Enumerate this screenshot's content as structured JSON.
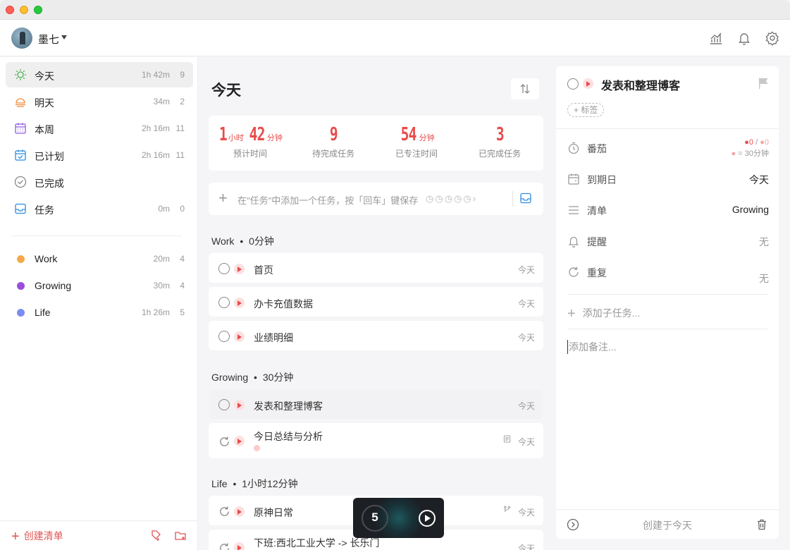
{
  "header": {
    "username": "墨七",
    "icons": [
      "stats-icon",
      "bell-icon",
      "gear-icon"
    ]
  },
  "sidebar": {
    "smart_lists": [
      {
        "label": "今天",
        "time": "1h 42m",
        "count": "9",
        "icon": "sun-icon",
        "active": true
      },
      {
        "label": "明天",
        "time": "34m",
        "count": "2",
        "icon": "sunrise-icon"
      },
      {
        "label": "本周",
        "time": "2h 16m",
        "count": "11",
        "icon": "calendar-week-icon"
      },
      {
        "label": "已计划",
        "time": "2h 16m",
        "count": "11",
        "icon": "calendar-check-icon"
      },
      {
        "label": "已完成",
        "time": "",
        "count": "",
        "icon": "check-circle-icon"
      },
      {
        "label": "任务",
        "time": "0m",
        "count": "0",
        "icon": "inbox-icon"
      }
    ],
    "lists": [
      {
        "label": "Work",
        "time": "20m",
        "count": "4",
        "color": "#f5a94a"
      },
      {
        "label": "Growing",
        "time": "30m",
        "count": "4",
        "color": "#9b4de0"
      },
      {
        "label": "Life",
        "time": "1h 26m",
        "count": "5",
        "color": "#7b8cf0"
      }
    ],
    "create_list": "创建清单"
  },
  "main": {
    "title": "今天",
    "stats": {
      "est_hours": "1",
      "est_hours_unit": "小时",
      "est_minutes": "42",
      "est_minutes_unit": "分钟",
      "est_label": "预计时间",
      "pending": "9",
      "pending_label": "待完成任务",
      "focused": "54",
      "focused_unit": "分钟",
      "focused_label": "已专注时间",
      "done": "3",
      "done_label": "已完成任务"
    },
    "add_placeholder": "在\"任务\"中添加一个任务，按「回车」键保存",
    "groups": [
      {
        "title": "Work",
        "duration": "0分钟",
        "tasks": [
          {
            "name": "首页",
            "date": "今天"
          },
          {
            "name": "办卡充值数据",
            "date": "今天"
          },
          {
            "name": "业绩明细",
            "date": "今天"
          }
        ]
      },
      {
        "title": "Growing",
        "duration": "30分钟",
        "tasks": [
          {
            "name": "发表和整理博客",
            "date": "今天",
            "selected": true
          },
          {
            "name": "今日总结与分析",
            "date": "今天",
            "repeat": true,
            "note": true
          }
        ]
      },
      {
        "title": "Life",
        "duration": "1小时12分钟",
        "tasks": [
          {
            "name": "原神日常",
            "date": "今天",
            "repeat": true,
            "subtasks": true
          },
          {
            "name": "下班:西北工业大学 -> 长乐门",
            "date": "今天",
            "repeat": true
          }
        ]
      }
    ],
    "group_separator": "•"
  },
  "timer": {
    "value": "5"
  },
  "detail": {
    "title": "发表和整理博客",
    "tag_button": "+ 标签",
    "pomodoro_label": "番茄",
    "pomodoro_done": "0",
    "pomodoro_slash": "/",
    "pomodoro_est": "0",
    "pomodoro_unit": "= 30分钟",
    "due_label": "到期日",
    "due_value": "今天",
    "list_label": "清单",
    "list_value": "Growing",
    "reminder_label": "提醒",
    "reminder_value": "无",
    "repeat_label": "重复",
    "repeat_value": "无",
    "add_subtask": "添加子任务...",
    "note_placeholder": "添加备注...",
    "created": "创建于今天"
  }
}
